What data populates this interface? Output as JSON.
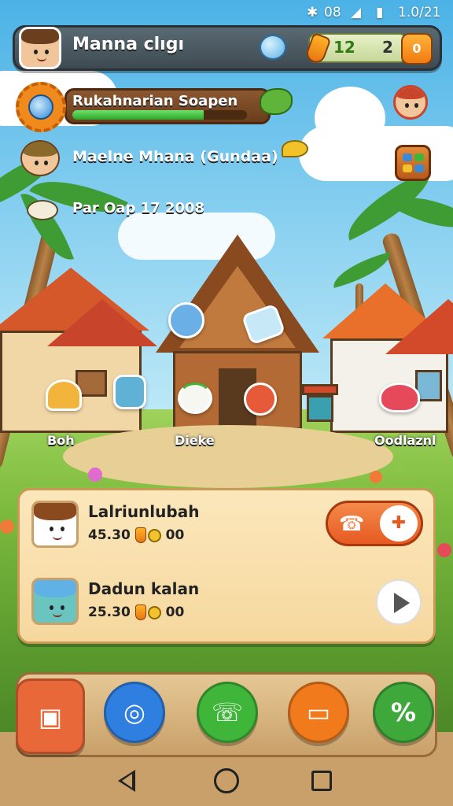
{
  "status_bar": {
    "signal_text": "08",
    "time": "1.0/21"
  },
  "top_bar": {
    "player_name": "Manna clıgı",
    "currency_carrots": "12",
    "currency_count": "2",
    "coin_button_label": "0"
  },
  "quest": {
    "title": "Rukahnarian   Soapen",
    "progress": 0.75
  },
  "villager": {
    "name": "Maelne Mhana (Gundaa)"
  },
  "date": {
    "text": "Par Oap 17 2008"
  },
  "scene": {
    "labels": {
      "left": "Boh",
      "center": "Dieke",
      "right": "Oodlaznl"
    }
  },
  "panel": {
    "rows": [
      {
        "name": "Lalriunlubah",
        "reward_amount": "45.30",
        "reward_coins": "00"
      },
      {
        "name": "Dadun kalan",
        "reward_amount": "25.30",
        "reward_coins": "00"
      }
    ]
  },
  "dock": {
    "buttons": [
      {
        "icon": "calendar-icon",
        "color": "#e9683a"
      },
      {
        "icon": "camera-chat-icon",
        "color": "#2f7fe0"
      },
      {
        "icon": "phone-icon",
        "color": "#3fb53a"
      },
      {
        "icon": "video-icon",
        "color": "#f07a1c"
      },
      {
        "icon": "percent-icon",
        "color": "#3fa83a"
      }
    ]
  }
}
